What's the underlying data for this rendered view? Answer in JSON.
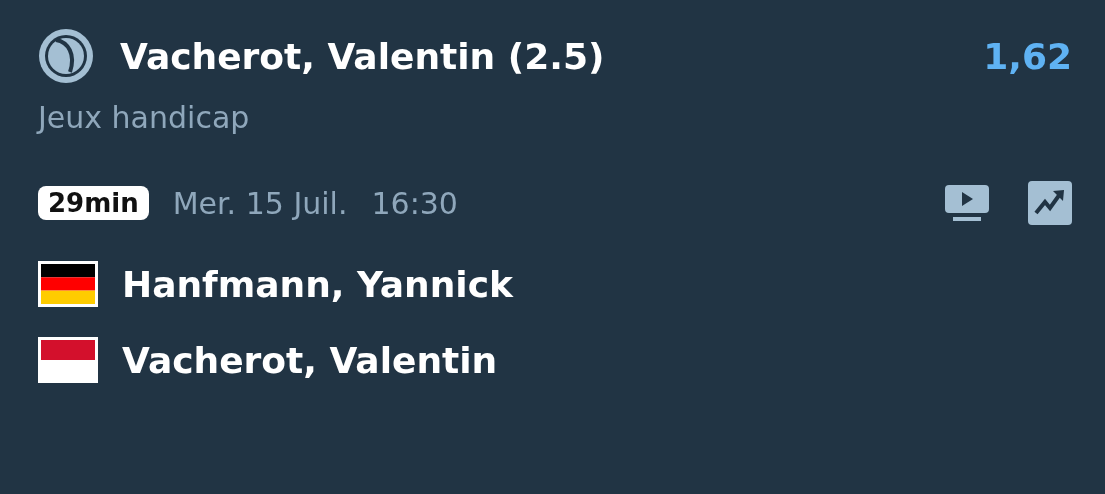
{
  "selection": {
    "title": "Vacherot, Valentin (2.5)",
    "odds": "1,62",
    "market": "Jeux handicap"
  },
  "event": {
    "countdown": "29min",
    "date": "Mer. 15 Juil.",
    "time": "16:30"
  },
  "players": [
    {
      "name": "Hanfmann, Yannick",
      "kind": "de"
    },
    {
      "name": "Vacherot, Valentin",
      "kind": "mc"
    }
  ]
}
